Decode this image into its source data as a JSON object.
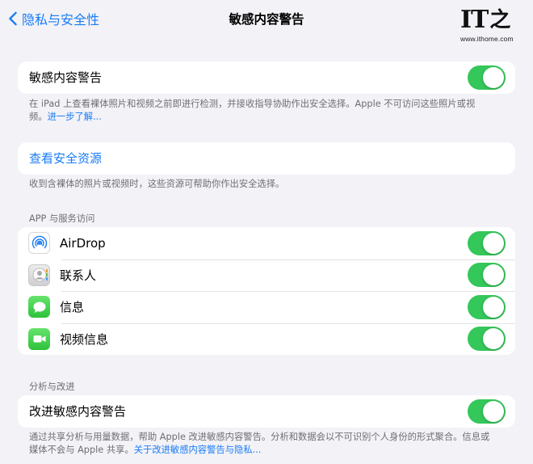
{
  "nav": {
    "back_label": "隐私与安全性",
    "title": "敏感内容警告"
  },
  "watermark": {
    "logo_text": "IT",
    "logo_char": "之家",
    "url": "www.ithome.com"
  },
  "main_toggle": {
    "label": "敏感内容警告",
    "on": true
  },
  "main_footer": {
    "text": "在 iPad 上查看裸体照片和视频之前即进行检测，并接收指导协助作出安全选择。Apple 不可访问这些照片或视频。",
    "link": "进一步了解..."
  },
  "resources": {
    "label": "查看安全资源",
    "footer": "收到含裸体的照片或视频时，这些资源可帮助你作出安全选择。"
  },
  "apps_section": {
    "header": "APP 与服务访问",
    "items": [
      {
        "label": "AirDrop",
        "icon": "airdrop-icon",
        "on": true
      },
      {
        "label": "联系人",
        "icon": "contacts-icon",
        "on": true
      },
      {
        "label": "信息",
        "icon": "messages-icon",
        "on": true
      },
      {
        "label": "视频信息",
        "icon": "facetime-icon",
        "on": true
      }
    ]
  },
  "analytics_section": {
    "header": "分析与改进",
    "toggle_label": "改进敏感内容警告",
    "on": true,
    "footer": "通过共享分析与用量数据，帮助 Apple 改进敏感内容警告。分析和数据会以不可识别个人身份的形式聚合。信息或媒体不会与 Apple 共享。",
    "footer_link": "关于改进敏感内容警告与隐私..."
  },
  "colors": {
    "accent": "#1a7cf5",
    "toggle_on": "#34c759",
    "background": "#f2f2f7"
  }
}
